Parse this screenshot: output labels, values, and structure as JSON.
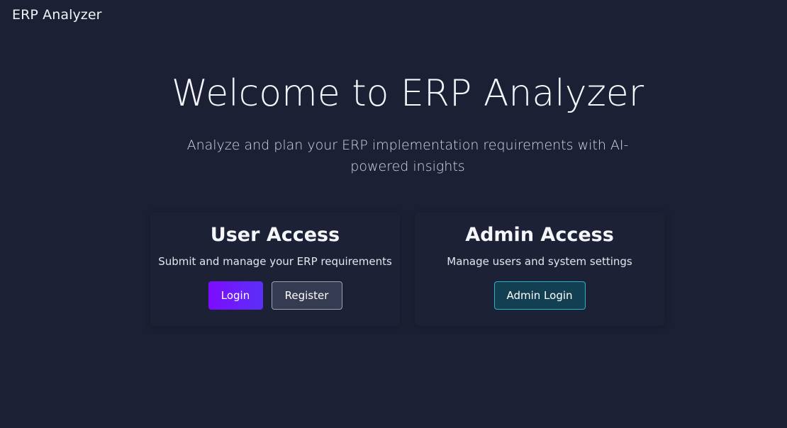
{
  "header": {
    "brand": "ERP Analyzer"
  },
  "hero": {
    "title": "Welcome to ERP Analyzer",
    "subtitle": "Analyze and plan your ERP implementation requirements with AI-powered insights"
  },
  "cards": {
    "user": {
      "title": "User Access",
      "description": "Submit and manage your ERP requirements",
      "login_label": "Login",
      "register_label": "Register"
    },
    "admin": {
      "title": "Admin Access",
      "description": "Manage users and system settings",
      "admin_login_label": "Admin Login"
    }
  },
  "colors": {
    "background": "#1b2034",
    "login_gradient_start": "#7d0cff",
    "login_gradient_end": "#5b2ff6",
    "admin_button_bg": "#133f52",
    "admin_button_border": "#25b3c9"
  }
}
